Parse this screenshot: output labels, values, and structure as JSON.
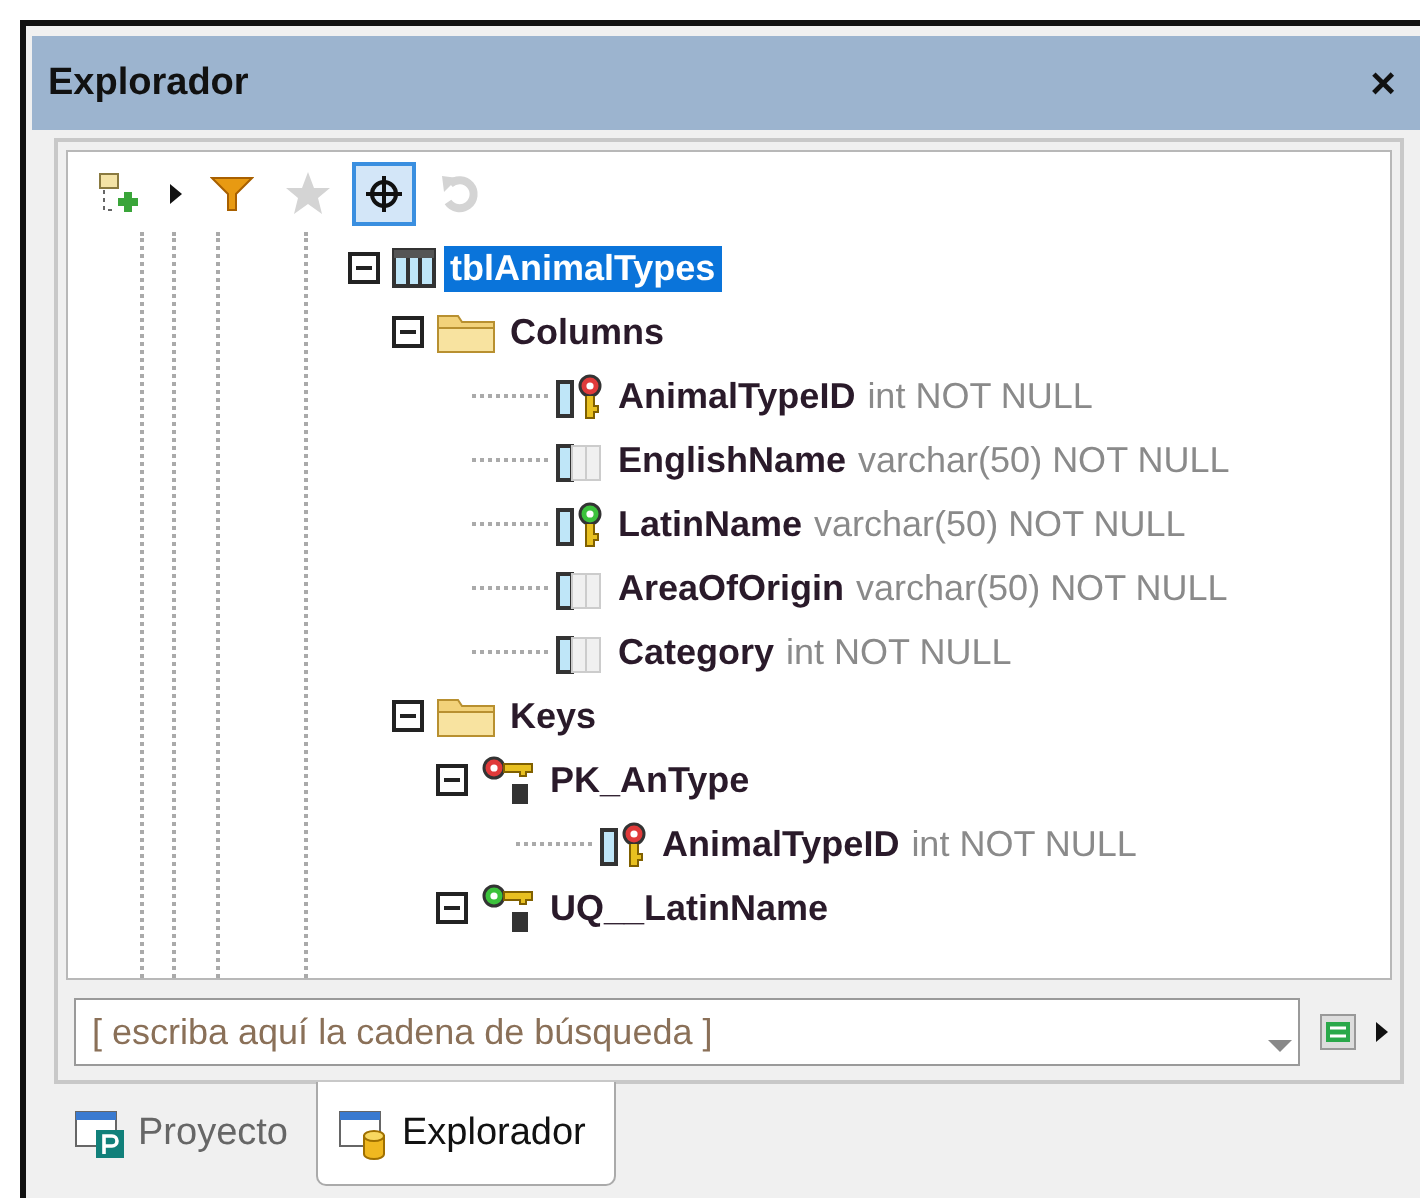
{
  "window": {
    "title": "Explorador",
    "close": "×"
  },
  "toolbar": [
    {
      "kind": "add-folder",
      "disabled": false,
      "on": false
    },
    {
      "kind": "caret",
      "disabled": false,
      "on": false
    },
    {
      "kind": "filter",
      "disabled": false,
      "on": false
    },
    {
      "kind": "star",
      "disabled": true,
      "on": false
    },
    {
      "kind": "locate",
      "disabled": false,
      "on": true
    },
    {
      "kind": "undo",
      "disabled": true,
      "on": false
    }
  ],
  "tree": [
    {
      "kind": "table",
      "name": "tblAnimalTypes",
      "selected": true,
      "expanded": true,
      "children": [
        {
          "kind": "folder",
          "name": "Columns",
          "selected": false,
          "expanded": true,
          "children": [
            {
              "kind": "primary-column",
              "name": "AnimalTypeID",
              "type": "int NOT NULL",
              "selected": false
            },
            {
              "kind": "column",
              "name": "EnglishName",
              "type": "varchar(50) NOT NULL",
              "selected": false
            },
            {
              "kind": "unique-column",
              "name": "LatinName",
              "type": "varchar(50) NOT NULL",
              "selected": false
            },
            {
              "kind": "column",
              "name": "AreaOfOrigin",
              "type": "varchar(50) NOT NULL",
              "selected": false
            },
            {
              "kind": "column",
              "name": "Category",
              "type": "int NOT NULL",
              "selected": false
            }
          ]
        },
        {
          "kind": "folder",
          "name": "Keys",
          "selected": false,
          "expanded": true,
          "children": [
            {
              "kind": "primary-key",
              "name": "PK_AnType",
              "selected": false,
              "expanded": true,
              "children": [
                {
                  "kind": "primary-column",
                  "name": "AnimalTypeID",
                  "type": "int NOT NULL",
                  "selected": false
                }
              ]
            },
            {
              "kind": "unique-key",
              "name": "UQ__LatinName",
              "selected": false,
              "expanded": true
            }
          ]
        }
      ]
    }
  ],
  "search": {
    "placeholder": "[ escriba aquí la cadena de búsqueda ]"
  },
  "tabs": [
    {
      "label": "Proyecto",
      "kind": "project",
      "selected": false
    },
    {
      "label": "Explorador",
      "kind": "explorer",
      "selected": true
    }
  ]
}
